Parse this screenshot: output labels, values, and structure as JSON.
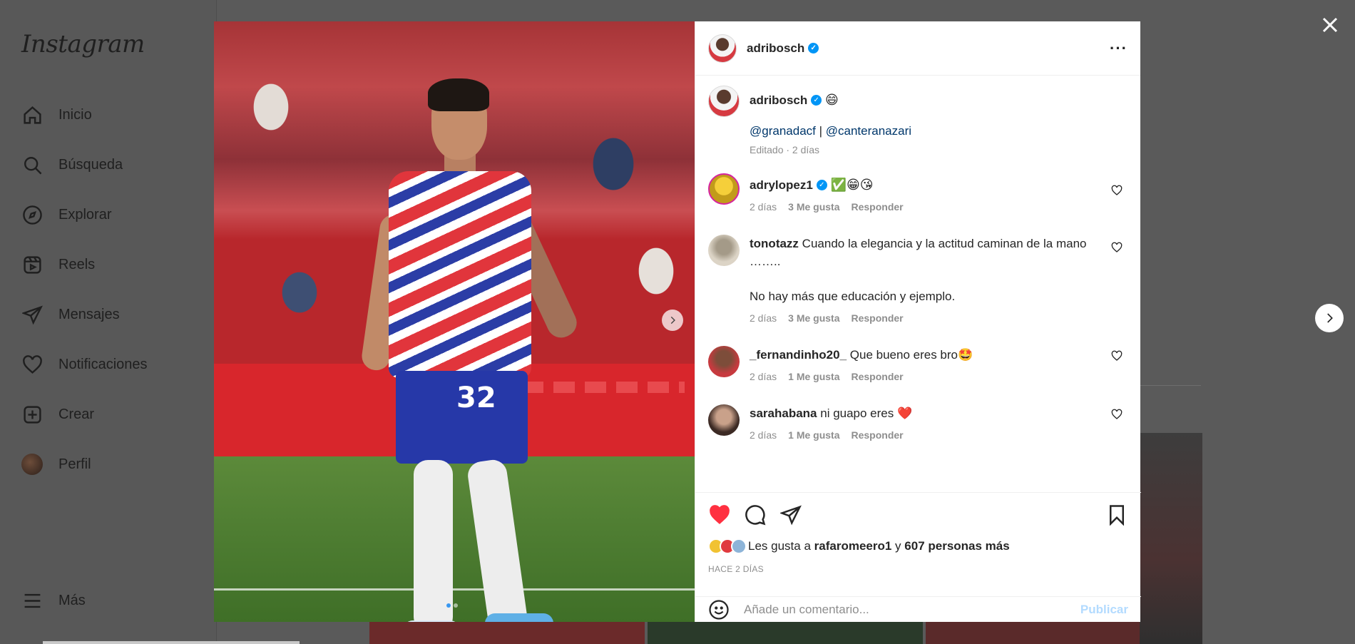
{
  "sidebar": {
    "logo": "Instagram",
    "items": [
      {
        "label": "Inicio"
      },
      {
        "label": "Búsqueda"
      },
      {
        "label": "Explorar"
      },
      {
        "label": "Reels"
      },
      {
        "label": "Mensajes"
      },
      {
        "label": "Notificaciones"
      },
      {
        "label": "Crear"
      },
      {
        "label": "Perfil"
      }
    ],
    "more_label": "Más"
  },
  "post": {
    "owner": "adribosch",
    "image_dots": {
      "count": 2,
      "active": 1
    },
    "caption": {
      "username": "adribosch",
      "emoji": "😄",
      "mention_1": "@granadacf",
      "separator": " | ",
      "mention_2": "@canteranazari",
      "edited": "Editado · 2 días"
    },
    "comments": [
      {
        "username": "adrylopez1",
        "text": "✅😁😘",
        "time": "2 días",
        "likes": "3 Me gusta",
        "reply": "Responder"
      },
      {
        "username": "tonotazz",
        "text": "Cuando la elegancia y la actitud caminan de la mano ……..",
        "text_2": "No hay más que educación y ejemplo.",
        "time": "2 días",
        "likes": "3 Me gusta",
        "reply": "Responder"
      },
      {
        "username": "_fernandinho20_",
        "text": "Que bueno eres bro🤩",
        "time": "2 días",
        "likes": "1 Me gusta",
        "reply": "Responder"
      },
      {
        "username": "sarahabana",
        "text": "ni guapo eres ❤️",
        "time": "2 días",
        "likes": "1 Me gusta",
        "reply": "Responder"
      }
    ],
    "likes": {
      "prefix": "Les gusta a",
      "user": "rafaromeero1",
      "conj": "y",
      "others": "607 personas más"
    },
    "time_ago": "HACE 2 DÍAS",
    "add_comment": {
      "placeholder": "Añade un comentario...",
      "publish": "Publicar"
    }
  },
  "icons": {
    "close": "close-icon",
    "next_post": "chevron-right-icon",
    "like": "heart-icon",
    "comment": "comment-icon",
    "share": "paper-plane-icon",
    "save": "bookmark-icon",
    "emoji": "smiley-icon"
  },
  "colors": {
    "accent": "#0095f6",
    "like": "#ff3040",
    "mention": "#00376b",
    "publish_disabled": "#b3dbff"
  }
}
